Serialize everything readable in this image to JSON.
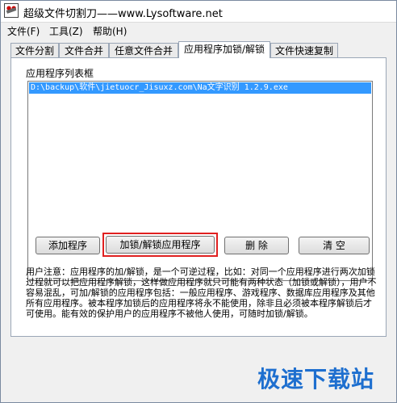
{
  "window": {
    "title": "超级文件切割刀——www.Lysoftware.net",
    "icon": "knife-app-icon"
  },
  "menu": [
    {
      "label": "文件(F)"
    },
    {
      "label": "工具(Z)"
    },
    {
      "label": "帮助(H)"
    }
  ],
  "tabs": [
    {
      "label": "文件分割",
      "active": false
    },
    {
      "label": "文件合并",
      "active": false
    },
    {
      "label": "任意文件合并",
      "active": false
    },
    {
      "label": "应用程序加锁/解锁",
      "active": true
    },
    {
      "label": "文件快速复制",
      "active": false
    }
  ],
  "panel": {
    "group_label": "应用程序列表框",
    "list_items": [
      "D:\\backup\\软件\\jietuocr_Jisuxz.com\\Na文字识别 1.2.9.exe"
    ],
    "buttons": {
      "add": "添加程序",
      "lock_unlock": "加锁/解锁应用程序",
      "delete": "删 除",
      "clear": "清 空"
    },
    "notice": "用户注意：应用程序的加/解锁，是一个可逆过程，比如：对同一个应用程序进行两次加锁过程就可以把应用程序解锁，这样做应用程序就只可能有两种状态（加锁或解锁），用户不容易混乱，可加/解锁的应用程序包括：一般应用程序、游戏程序、数据库应用程序及其他所有应用程序。被本程序加锁后的应用程序将永不能使用，除非且必须被本程序解锁后才可使用。能有效的保护用户的应用程序不被他人使用，可随时加锁/解锁。"
  },
  "watermark": "极速下载站",
  "colors": {
    "selection": "#3399ff",
    "highlight_border": "#e02020",
    "watermark": "#1e6fcf"
  }
}
